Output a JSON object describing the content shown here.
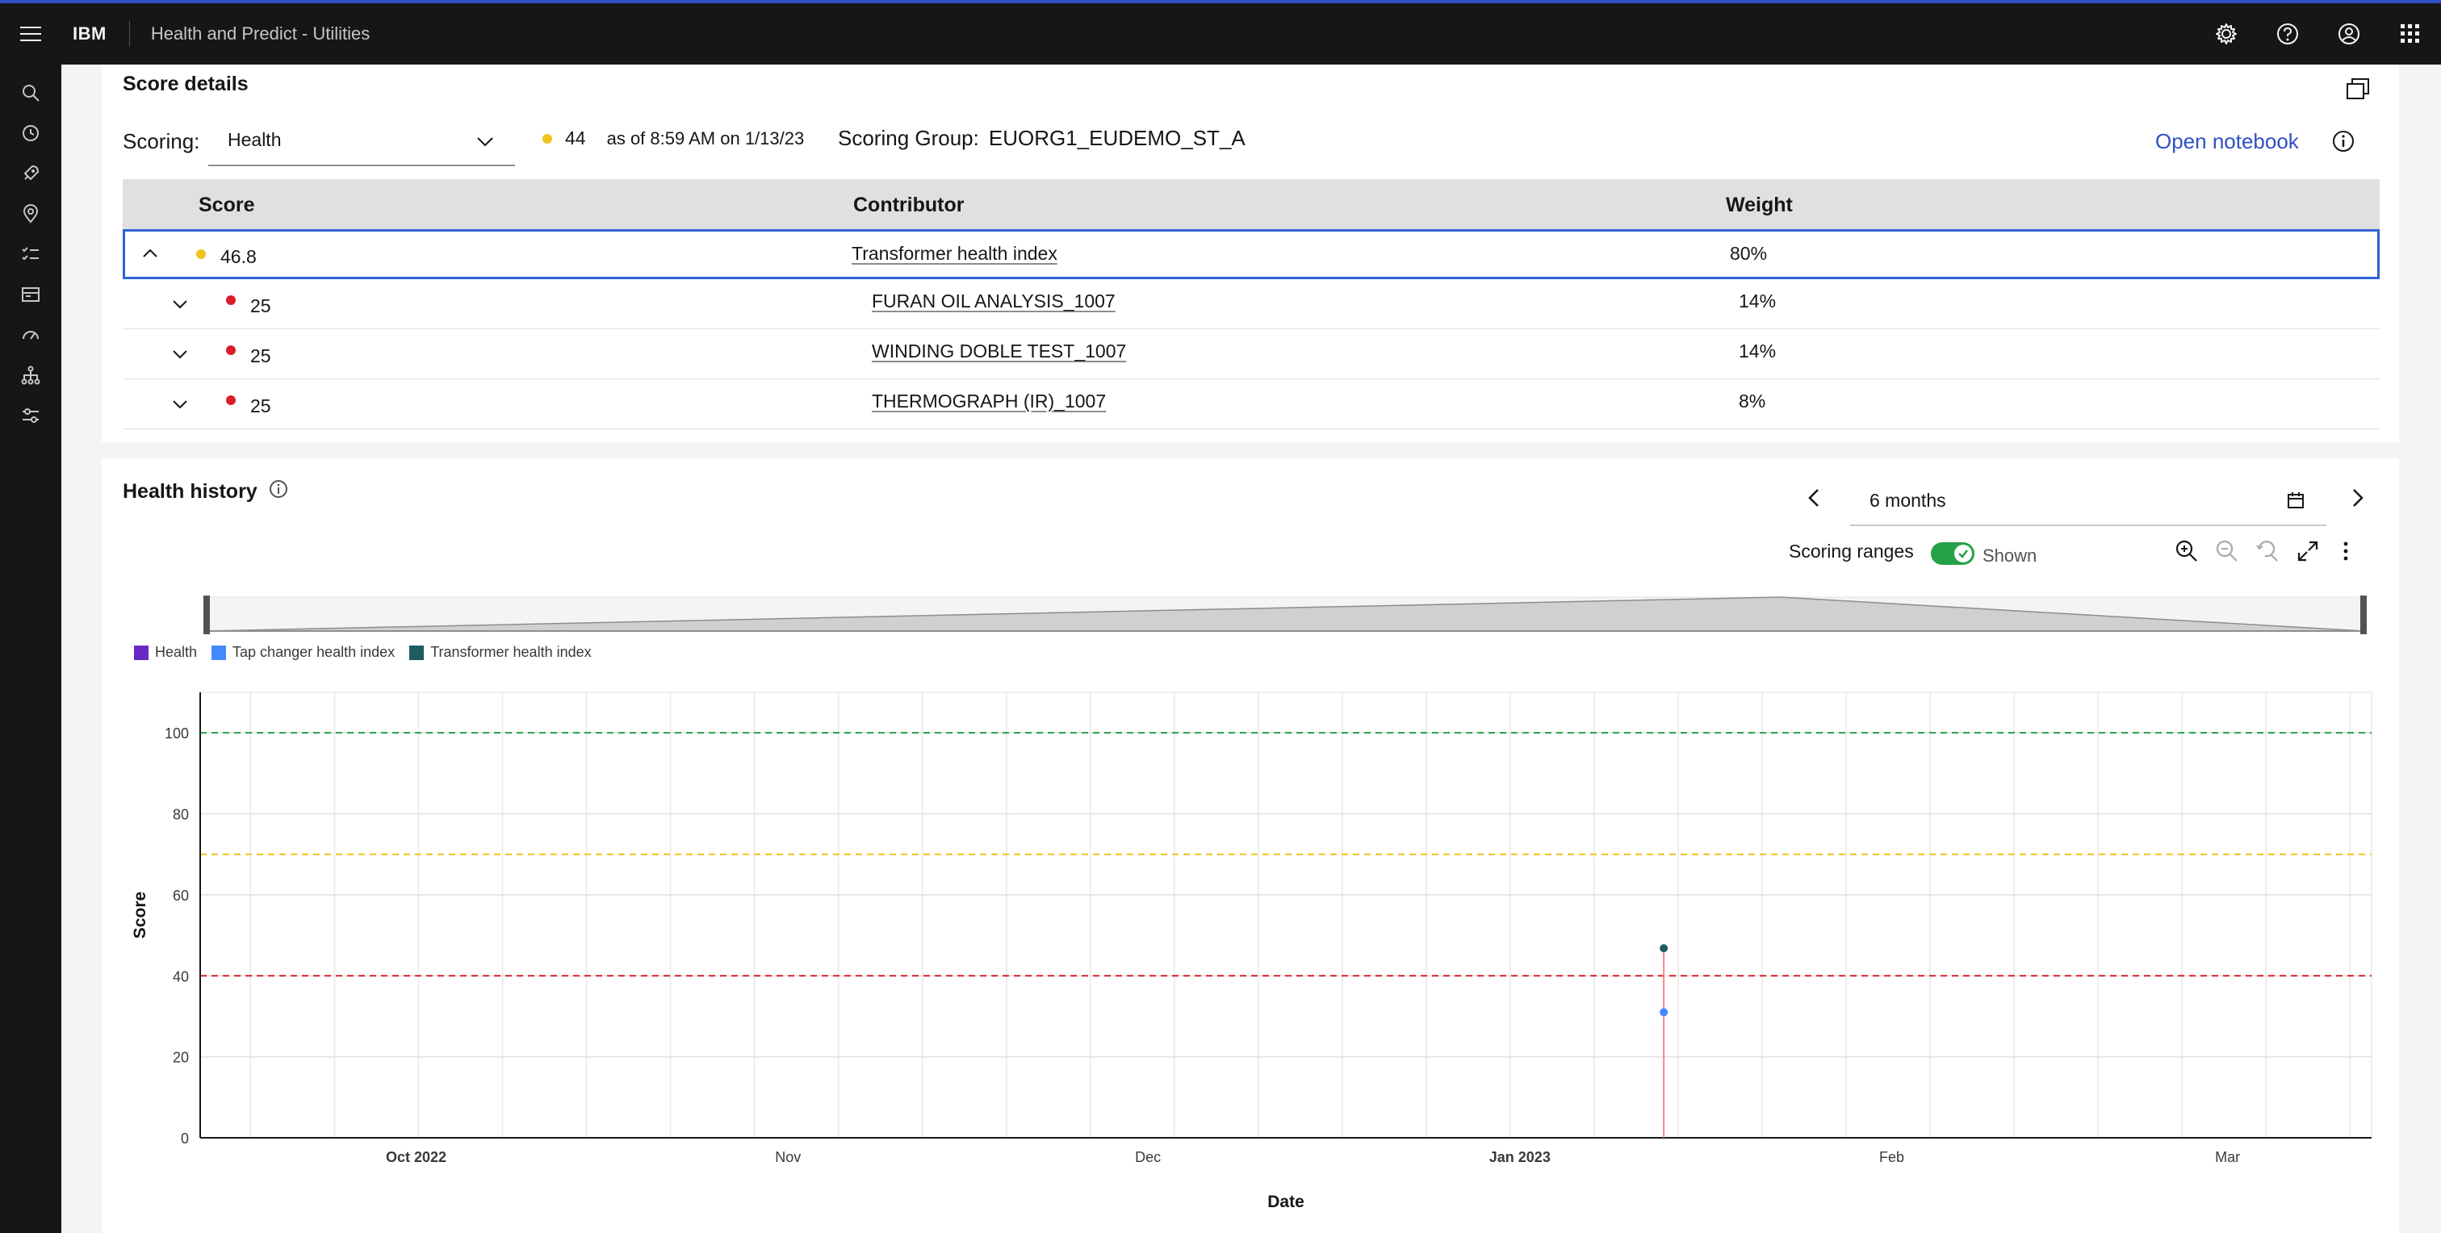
{
  "header": {
    "brand": "IBM",
    "app_title": "Health and Predict - Utilities",
    "icons": [
      "settings-icon",
      "help-icon",
      "user-icon",
      "app-switcher-icon"
    ]
  },
  "rail": {
    "icons": [
      "search-icon",
      "history-icon",
      "rocket-icon",
      "location-icon",
      "checklist-icon",
      "dashboard-icon",
      "gauge-icon",
      "hierarchy-icon",
      "sliders-icon"
    ]
  },
  "score_details": {
    "title": "Score details",
    "scoring_label": "Scoring:",
    "scoring_value": "Health",
    "current_score": "44",
    "as_of": "as of 8:59 AM on 1/13/23",
    "scoring_group_label": "Scoring Group:",
    "scoring_group_value": "EUORG1_EUDEMO_ST_A",
    "open_notebook": "Open notebook",
    "columns": [
      "Score",
      "Contributor",
      "Weight"
    ],
    "rows": [
      {
        "score": "46.8",
        "contributor": "Transformer health index",
        "weight": "80%",
        "status_color": "#f1c21b"
      },
      {
        "score": "25",
        "contributor": "FURAN OIL ANALYSIS_1007",
        "weight": "14%",
        "status_color": "#da1e28"
      },
      {
        "score": "25",
        "contributor": "WINDING DOBLE TEST_1007",
        "weight": "14%",
        "status_color": "#da1e28"
      },
      {
        "score": "25",
        "contributor": "THERMOGRAPH (IR)_1007",
        "weight": "8%",
        "status_color": "#da1e28"
      }
    ]
  },
  "health_history": {
    "title": "Health history",
    "range_value": "6 months",
    "scoring_ranges_label": "Scoring ranges",
    "scoring_ranges_state": "Shown",
    "legend": [
      {
        "name": "Health",
        "color": "#6929c4"
      },
      {
        "name": "Tap changer health index",
        "color": "#4589ff"
      },
      {
        "name": "Transformer health index",
        "color": "#1f5c5c"
      }
    ]
  },
  "chart_data": {
    "type": "scatter",
    "xlabel": "Date",
    "ylabel": "Score",
    "ylim": [
      0,
      110
    ],
    "x_range": [
      "2022-09-13",
      "2023-03-13"
    ],
    "x_ticks": [
      {
        "label": "Oct 2022",
        "date": "2022-10-01",
        "bold": true
      },
      {
        "label": "Nov",
        "date": "2022-11-01",
        "bold": false
      },
      {
        "label": "Dec",
        "date": "2022-12-01",
        "bold": false
      },
      {
        "label": "Jan 2023",
        "date": "2023-01-01",
        "bold": true
      },
      {
        "label": "Feb",
        "date": "2023-02-01",
        "bold": false
      },
      {
        "label": "Mar",
        "date": "2023-03-01",
        "bold": false
      }
    ],
    "y_ticks": [
      0,
      20,
      40,
      60,
      80,
      100
    ],
    "grid": true,
    "scoring_ranges": [
      {
        "value": 100,
        "color": "#24a148"
      },
      {
        "value": 70,
        "color": "#f1c21b"
      },
      {
        "value": 40,
        "color": "#da1e28"
      }
    ],
    "series": [
      {
        "name": "Transformer health index",
        "color": "#1f5c5c",
        "points": [
          {
            "x": "2023-01-13",
            "y": 46.8
          }
        ]
      },
      {
        "name": "Tap changer health index",
        "color": "#4589ff",
        "points": [
          {
            "x": "2023-01-13",
            "y": 31
          }
        ]
      }
    ],
    "marker_line": {
      "x": "2023-01-13",
      "color": "#ff8389"
    }
  }
}
